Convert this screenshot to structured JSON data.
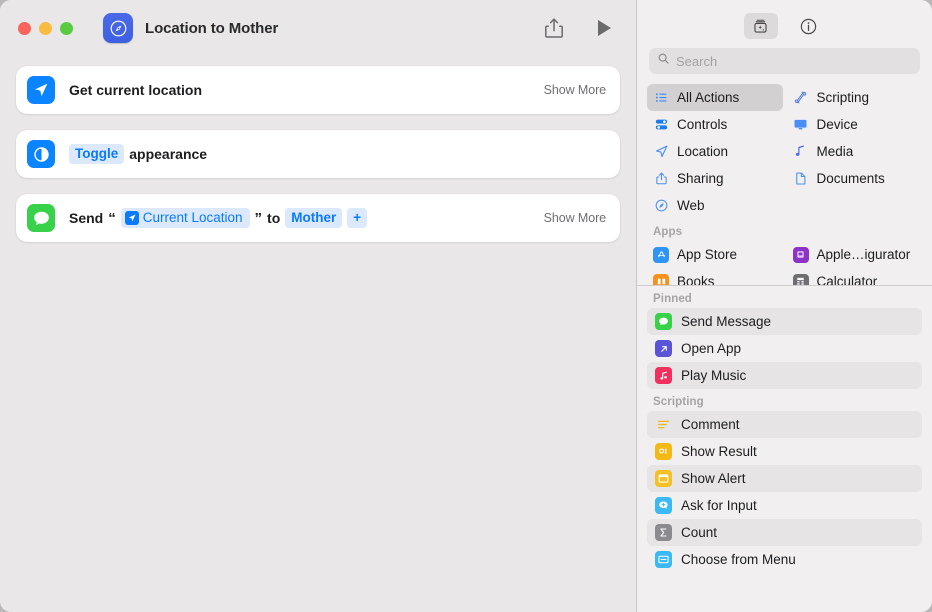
{
  "window": {
    "title": "Location to Mother",
    "app_icon": "shortcuts-compass-icon",
    "traffic_lights": [
      "close",
      "minimize",
      "zoom"
    ],
    "share_label": "share-icon",
    "run_label": "run-icon"
  },
  "editor": {
    "actions": [
      {
        "icon": "location-arrow-icon",
        "icon_color": "#0a84ff",
        "text": "Get current location",
        "show_more": "Show More",
        "has_show_more": true
      },
      {
        "icon": "appearance-toggle-icon",
        "icon_color": "#0a84ff",
        "chip": "Toggle",
        "text": "appearance",
        "has_show_more": false
      },
      {
        "icon": "messages-bubble-icon",
        "icon_color": "#37d14a",
        "verb": "Send",
        "open_quote": "“",
        "token": "Current Location",
        "token_icon": "location-arrow-icon",
        "close_quote": "”",
        "preposition": "to",
        "recipient": "Mother",
        "add_label": "+",
        "show_more": "Show More",
        "has_show_more": true
      }
    ]
  },
  "library": {
    "toolbar": [
      {
        "name": "action-library-icon",
        "active": true
      },
      {
        "name": "info-icon",
        "active": false
      }
    ],
    "search": {
      "placeholder": "Search",
      "value": "",
      "icon": "search-icon"
    },
    "categories": [
      {
        "label": "All Actions",
        "icon": "list-bullet-icon",
        "selected": true,
        "color": "#3a88fd"
      },
      {
        "label": "Scripting",
        "icon": "scripting-icon",
        "selected": false,
        "color": "#5a7fd6"
      },
      {
        "label": "Controls",
        "icon": "controls-icon",
        "selected": false,
        "color": "#1b7bf0"
      },
      {
        "label": "Device",
        "icon": "device-icon",
        "selected": false,
        "color": "#4a8ff5"
      },
      {
        "label": "Location",
        "icon": "location-arrow-icon",
        "selected": false,
        "color": "#4a8ff5"
      },
      {
        "label": "Media",
        "icon": "music-note-icon",
        "selected": false,
        "color": "#4a6ae8"
      },
      {
        "label": "Sharing",
        "icon": "share-icon",
        "selected": false,
        "color": "#4a8ff5"
      },
      {
        "label": "Documents",
        "icon": "document-icon",
        "selected": false,
        "color": "#4a8ff5"
      },
      {
        "label": "Web",
        "icon": "safari-compass-icon",
        "selected": false,
        "color": "#4a8ff5"
      }
    ],
    "apps_label": "Apps",
    "apps": [
      {
        "label": "App Store",
        "icon": "app-store-icon",
        "color": "#2f95f5"
      },
      {
        "label": "Apple…igurator",
        "icon": "apple-configurator-icon",
        "color": "#8c34c8"
      },
      {
        "label": "Books",
        "icon": "books-icon",
        "color": "#f5921e"
      },
      {
        "label": "Calculator",
        "icon": "calculator-icon",
        "color": "#6e6e73"
      }
    ],
    "pinned_label": "Pinned",
    "pinned": [
      {
        "label": "Send Message",
        "icon": "messages-bubble-icon",
        "color": "#37d14a"
      },
      {
        "label": "Open App",
        "icon": "open-app-icon",
        "color": "#5a55d6"
      },
      {
        "label": "Play Music",
        "icon": "music-note-icon",
        "color": "#f2305e"
      }
    ],
    "scripting_label": "Scripting",
    "scripting": [
      {
        "label": "Comment",
        "icon": "comment-lines-icon",
        "color": "#f5b916"
      },
      {
        "label": "Show Result",
        "icon": "show-result-icon",
        "color": "#f5b916"
      },
      {
        "label": "Show Alert",
        "icon": "show-alert-icon",
        "color": "#f5c026"
      },
      {
        "label": "Ask for Input",
        "icon": "ask-input-icon",
        "color": "#3ab9f5"
      },
      {
        "label": "Count",
        "icon": "sigma-count-icon",
        "color": "#8a8a8f"
      },
      {
        "label": "Choose from Menu",
        "icon": "choose-menu-icon",
        "color": "#3ab9f5"
      }
    ]
  }
}
